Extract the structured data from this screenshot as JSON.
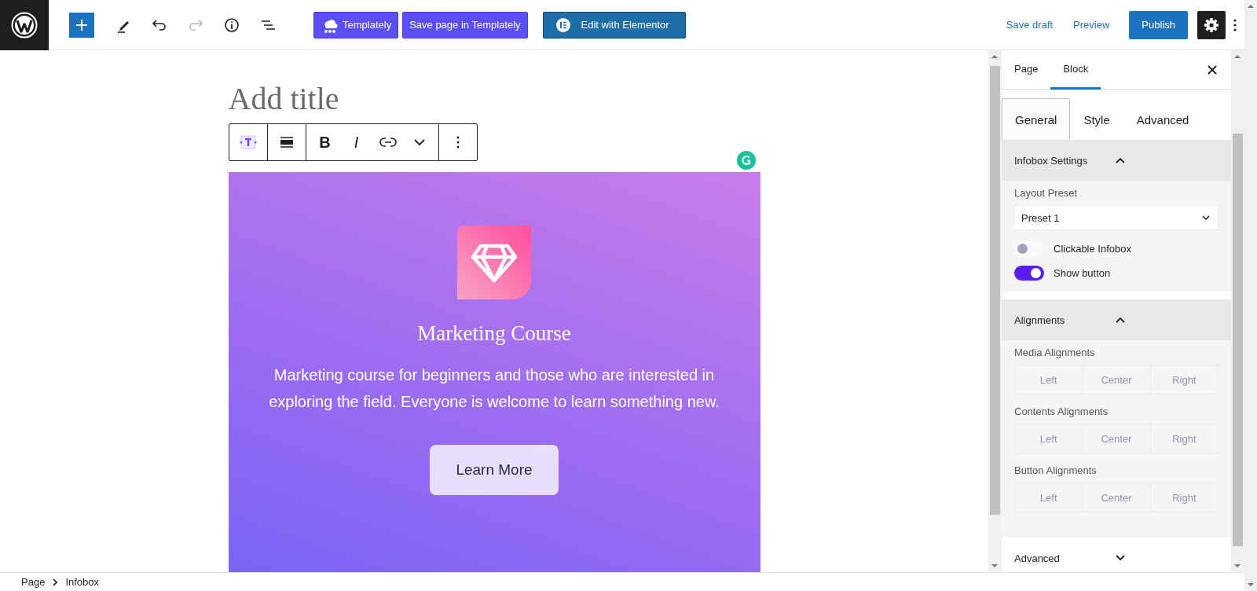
{
  "topbar": {
    "redo": {
      "disabled": true
    },
    "plugin_buttons": [
      {
        "kind": "templately",
        "label": "Templately"
      },
      {
        "kind": "plain",
        "label": "Save page in Templately"
      },
      {
        "kind": "elementor",
        "label": "Edit with Elementor"
      }
    ],
    "save_draft": "Save draft",
    "preview": "Preview",
    "publish": "Publish",
    "settings": {
      "selected": true
    }
  },
  "editor": {
    "title_placeholder": "Add title",
    "format_buttons": [
      "B",
      "I"
    ],
    "infobox": {
      "title": "Marketing Course",
      "description": "Marketing course for beginners and those who are interested in exploring the field. Everyone is welcome to learn something new.",
      "button": "Learn More"
    }
  },
  "sidebar": {
    "tabs": [
      {
        "label": "Page",
        "selected": false
      },
      {
        "label": "Block",
        "selected": true
      }
    ],
    "subtabs": [
      {
        "label": "General",
        "selected": true
      },
      {
        "label": "Style",
        "selected": false
      },
      {
        "label": "Advanced",
        "selected": false
      }
    ],
    "sections": [
      {
        "kind": "infobox",
        "title": "Infobox Settings",
        "expanded": true,
        "preset_label": "Layout Preset",
        "preset_value": "Preset 1",
        "toggles": [
          {
            "label": "Clickable Infobox",
            "on": false
          },
          {
            "label": "Show button",
            "on": true
          }
        ]
      },
      {
        "kind": "alignments",
        "title": "Alignments",
        "expanded": true,
        "groups": [
          {
            "label": "Media Alignments",
            "disabled": true,
            "options": [
              "Left",
              "Center",
              "Right"
            ]
          },
          {
            "label": "Contents Alignments",
            "disabled": true,
            "options": [
              "Left",
              "Center",
              "Right"
            ]
          },
          {
            "label": "Button Alignments",
            "disabled": true,
            "options": [
              "Left",
              "Center",
              "Right"
            ]
          }
        ]
      },
      {
        "kind": "plain",
        "title": "Advanced",
        "expanded": false
      }
    ]
  },
  "breadcrumb": [
    "Page",
    "Infobox"
  ]
}
